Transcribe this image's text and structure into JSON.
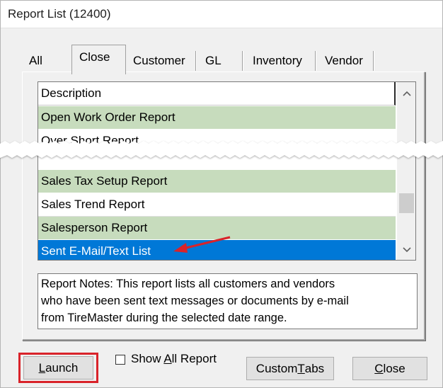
{
  "window": {
    "title": "Report List (12400)"
  },
  "tabs": [
    {
      "label": "All"
    },
    {
      "label": "Close",
      "active": true
    },
    {
      "label": "Customer"
    },
    {
      "label": "GL"
    },
    {
      "label": "Inventory"
    },
    {
      "label": "Vendor"
    }
  ],
  "list": {
    "header": "Description",
    "rows": [
      {
        "label": "Open Work Order Report",
        "style": "green"
      },
      {
        "label": "Over Short Report",
        "style": "white"
      },
      {
        "label": "Sales Tax Setup Report",
        "style": "green"
      },
      {
        "label": "Sales Trend Report",
        "style": "white"
      },
      {
        "label": "Salesperson Report",
        "style": "green"
      },
      {
        "label": "Sent E-Mail/Text List",
        "style": "selected"
      }
    ],
    "scroll_up_icon": "chevron-up-icon",
    "scroll_down_icon": "chevron-down-icon"
  },
  "notes": {
    "lines": [
      "Report Notes:  This report lists all customers and vendors",
      "who have been sent text messages or documents by e-mail",
      "from TireMaster during the selected date range."
    ]
  },
  "buttons": {
    "launch": {
      "pre": "",
      "ul": "L",
      "post": "aunch"
    },
    "show_all": {
      "pre": "Show ",
      "ul": "A",
      "post": "ll Report",
      "checked": false
    },
    "custom_tabs": {
      "pre": "Custom ",
      "ul": "T",
      "post": "abs"
    },
    "close": {
      "pre": "",
      "ul": "C",
      "post": "lose"
    }
  },
  "colors": {
    "row_green": "#c7dcbd",
    "selected": "#0078d7",
    "highlight": "#d9232a"
  },
  "annotation": {
    "arrow_icon": "red-arrow-icon"
  }
}
